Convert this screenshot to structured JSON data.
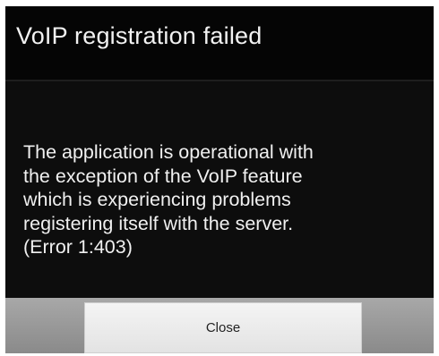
{
  "dialog": {
    "title": "VoIP registration failed",
    "message": "The application is operational with\nthe exception of the VoIP feature\nwhich is experiencing problems\nregistering itself with the server.\n(Error 1:403)",
    "buttons": {
      "close_label": "Close"
    }
  }
}
